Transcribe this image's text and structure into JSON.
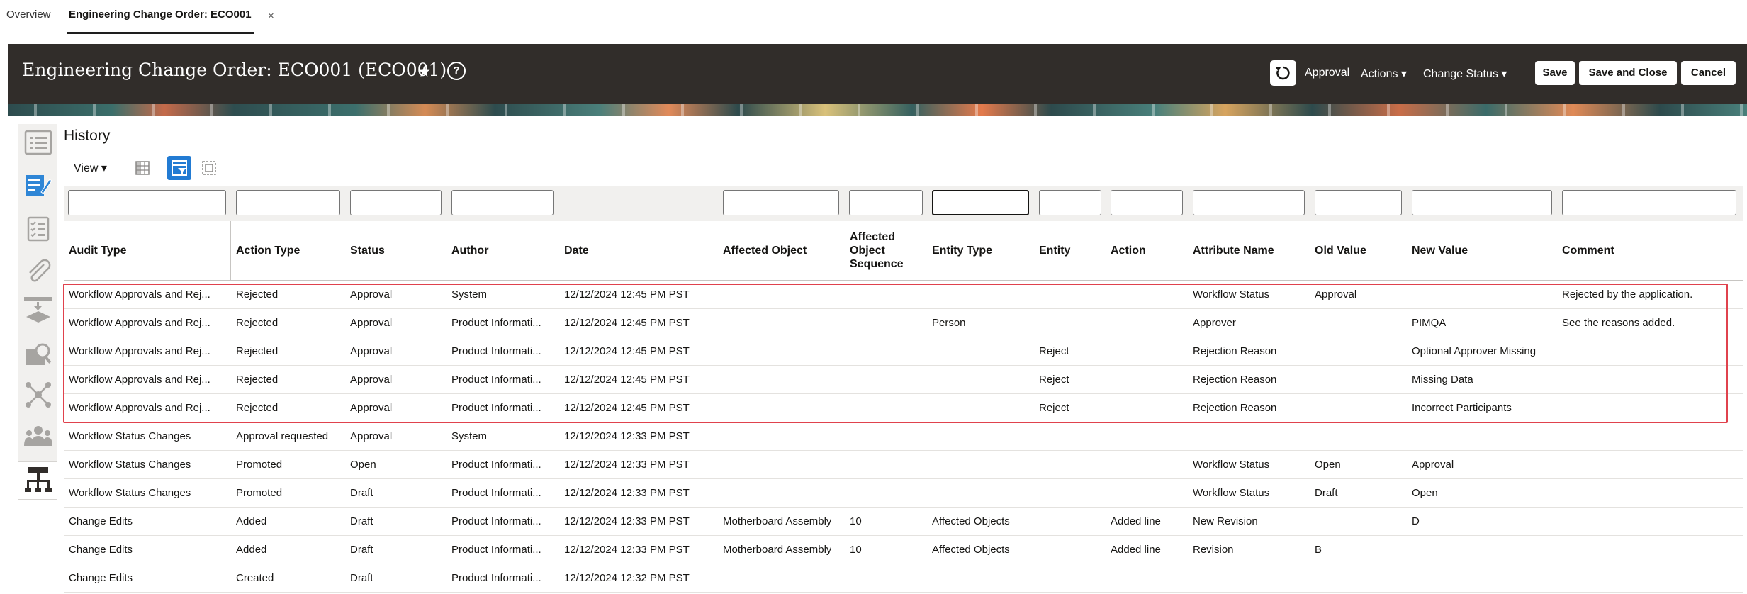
{
  "tabs": {
    "overview": "Overview",
    "active": "Engineering Change Order: ECO001",
    "close": "×"
  },
  "header": {
    "title": "Engineering Change Order: ECO001 (ECO001)",
    "star": "★",
    "help": "?",
    "approval": "Approval",
    "actions": "Actions ▾",
    "change_status": "Change Status ▾",
    "save": "Save",
    "save_and_close": "Save and Close",
    "cancel": "Cancel"
  },
  "history": {
    "title": "History",
    "view_menu": "View ▾"
  },
  "filters": {
    "entity_type_value": ""
  },
  "columns": [
    "Audit Type",
    "Action Type",
    "Status",
    "Author",
    "Date",
    "Affected Object",
    "Affected Object Sequence",
    "Entity Type",
    "Entity",
    "Action",
    "Attribute Name",
    "Old Value",
    "New Value",
    "Comment"
  ],
  "rows": [
    [
      "Workflow Approvals and Rej...",
      "Rejected",
      "Approval",
      "System",
      "12/12/2024 12:45 PM PST",
      "",
      "",
      "",
      "",
      "",
      "Workflow Status",
      "Approval",
      "",
      "Rejected by the application."
    ],
    [
      "Workflow Approvals and Rej...",
      "Rejected",
      "Approval",
      "Product Informati...",
      "12/12/2024 12:45 PM PST",
      "",
      "",
      "Person",
      "",
      "",
      "Approver",
      "",
      "PIMQA",
      "See the reasons added."
    ],
    [
      "Workflow Approvals and Rej...",
      "Rejected",
      "Approval",
      "Product Informati...",
      "12/12/2024 12:45 PM PST",
      "",
      "",
      "",
      "Reject",
      "",
      "Rejection Reason",
      "",
      "Optional Approver Missing",
      ""
    ],
    [
      "Workflow Approvals and Rej...",
      "Rejected",
      "Approval",
      "Product Informati...",
      "12/12/2024 12:45 PM PST",
      "",
      "",
      "",
      "Reject",
      "",
      "Rejection Reason",
      "",
      "Missing Data",
      ""
    ],
    [
      "Workflow Approvals and Rej...",
      "Rejected",
      "Approval",
      "Product Informati...",
      "12/12/2024 12:45 PM PST",
      "",
      "",
      "",
      "Reject",
      "",
      "Rejection Reason",
      "",
      "Incorrect Participants",
      ""
    ],
    [
      "Workflow Status Changes",
      "Approval requested",
      "Approval",
      "System",
      "12/12/2024 12:33 PM PST",
      "",
      "",
      "",
      "",
      "",
      "",
      "",
      "",
      ""
    ],
    [
      "Workflow Status Changes",
      "Promoted",
      "Open",
      "Product Informati...",
      "12/12/2024 12:33 PM PST",
      "",
      "",
      "",
      "",
      "",
      "Workflow Status",
      "Open",
      "Approval",
      ""
    ],
    [
      "Workflow Status Changes",
      "Promoted",
      "Draft",
      "Product Informati...",
      "12/12/2024 12:33 PM PST",
      "",
      "",
      "",
      "",
      "",
      "Workflow Status",
      "Draft",
      "Open",
      ""
    ],
    [
      "Change Edits",
      "Added",
      "Draft",
      "Product Informati...",
      "12/12/2024 12:33 PM PST",
      "Motherboard Assembly",
      "10",
      "Affected Objects",
      "",
      "Added line",
      "New Revision",
      "",
      "D",
      ""
    ],
    [
      "Change Edits",
      "Added",
      "Draft",
      "Product Informati...",
      "12/12/2024 12:33 PM PST",
      "Motherboard Assembly",
      "10",
      "Affected Objects",
      "",
      "Added line",
      "Revision",
      "B",
      "",
      ""
    ],
    [
      "Change Edits",
      "Created",
      "Draft",
      "Product Informati...",
      "12/12/2024 12:32 PM PST",
      "",
      "",
      "",
      "",
      "",
      "",
      "",
      "",
      ""
    ]
  ],
  "colors": {
    "header_bg": "#312d2a",
    "accent": "#227bd3",
    "highlight": "#e0424d"
  },
  "rail_icons": [
    "overview-icon",
    "edit-lines-icon",
    "checklist-icon",
    "attachment-icon",
    "workflow-icon",
    "search-image-icon",
    "network-icon",
    "people-icon",
    "history-tree-icon"
  ]
}
